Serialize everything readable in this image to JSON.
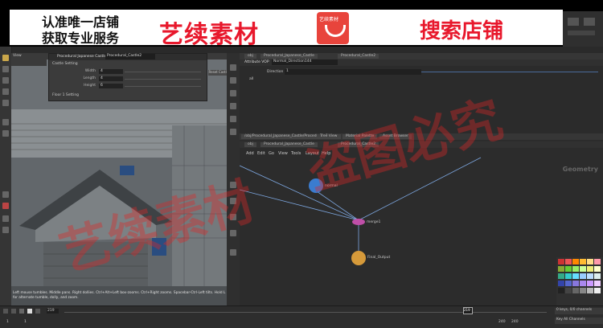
{
  "banner": {
    "left_line1": "认准唯一店铺",
    "left_line2": "获取专业服务",
    "brand": "艺续素材",
    "logo_tag": "艺续素材",
    "right_cta": "搜索店铺"
  },
  "watermark": {
    "line1": "艺续素材",
    "line2": "盗图必究"
  },
  "menu": {
    "file": "File"
  },
  "viewport": {
    "title": "Procedural Japanese Castle",
    "node_field": "Procedural_Castle2",
    "view_label": "View",
    "section1": "Castle Setting",
    "section2": "Floor 1 Setting",
    "reset_button": "Reset Castle",
    "params": [
      {
        "label": "Width",
        "value": "4"
      },
      {
        "label": "Length",
        "value": "4"
      },
      {
        "label": "Height",
        "value": "6"
      }
    ],
    "status_text": "Left mouse tumbles. Middle pans. Right dollies. Ctrl+Alt+Left box-zooms. Ctrl+Right zooms. Spacebar-Ctrl-Left tilts. Hold L for alternate tumble, dolly, and zoom."
  },
  "vp_tabs": [
    "obj",
    "Procedural_Japanese_Castle",
    "Procedural_Castle2"
  ],
  "attr_panel": {
    "title": "Attribute VOP",
    "name": "Normal_Direction144",
    "direction_label": "Direction",
    "direction_value": "1",
    "all_label": "all"
  },
  "network": {
    "path": "/obj/Procedural_Japanese_Castle/Procedural_Ca...",
    "tabs": [
      "Tree View",
      "Material Palette",
      "Asset Browser"
    ],
    "path_tabs": [
      "obj",
      "Procedural_Japanese_Castle",
      "Procedural_Castle2"
    ],
    "menu": [
      "Add",
      "Edit",
      "Go",
      "View",
      "Tools",
      "Layout",
      "Help"
    ],
    "context_label": "Geometry",
    "nodes": [
      {
        "name": "normal"
      },
      {
        "name": "merge1"
      },
      {
        "name": "Final_Output"
      }
    ]
  },
  "timeline": {
    "frame": "219",
    "start1": "1",
    "start2": "1",
    "end1": "240",
    "end2": "240",
    "marker": "219"
  },
  "channels": {
    "keys": "0 keys, 0/0 channels",
    "key_all": "Key All Channels"
  },
  "colors": {
    "brand_red": "#e8182c",
    "node_blue": "#3b7ccf",
    "node_pink": "#c04fa8",
    "node_orange": "#d69a3a",
    "wire": "#7da7e0"
  }
}
